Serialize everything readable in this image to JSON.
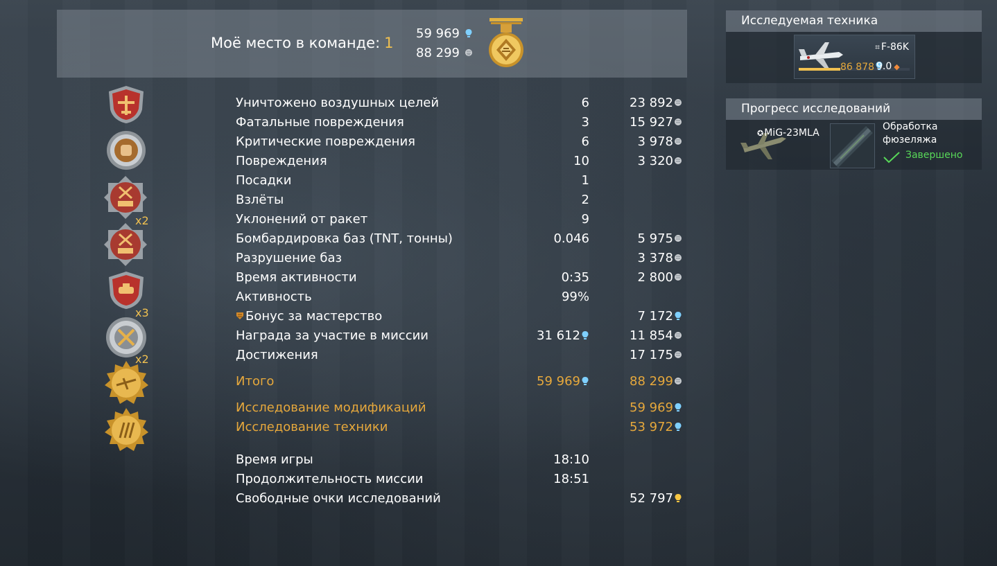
{
  "header": {
    "place_label": "Моё место в команде:",
    "place_value": "1",
    "rp_total": "59 969",
    "sl_total": "88 299"
  },
  "medal_multipliers": [
    "x2",
    "x3",
    "x2"
  ],
  "stats": [
    {
      "label": "Уничтожено воздушных целей",
      "v1": "6",
      "v2": "23 892",
      "v2_icon": "silver-lions-icon"
    },
    {
      "label": "Фатальные повреждения",
      "v1": "3",
      "v2": "15 927",
      "v2_icon": "silver-lions-icon"
    },
    {
      "label": "Критические повреждения",
      "v1": "6",
      "v2": "3 978",
      "v2_icon": "silver-lions-icon"
    },
    {
      "label": "Повреждения",
      "v1": "10",
      "v2": "3 320",
      "v2_icon": "silver-lions-icon"
    },
    {
      "label": "Посадки",
      "v1": "1",
      "v2": ""
    },
    {
      "label": "Взлёты",
      "v1": "2",
      "v2": ""
    },
    {
      "label": "Уклонений от ракет",
      "v1": "9",
      "v2": ""
    },
    {
      "label": "Бомбардировка баз (TNT, тонны)",
      "v1": "0.046",
      "v2": "5 975",
      "v2_icon": "silver-lions-icon"
    },
    {
      "label": "Разрушение баз",
      "v1": "",
      "v2": "3 378",
      "v2_icon": "silver-lions-icon"
    },
    {
      "label": "Время активности",
      "v1": "0:35",
      "v2": "2 800",
      "v2_icon": "silver-lions-icon"
    },
    {
      "label": "Активность",
      "v1": "99%",
      "v2": ""
    },
    {
      "label": "Бонус за мастерство",
      "v1": "",
      "v2": "7 172",
      "v2_icon": "research-points-icon"
    },
    {
      "label": "Награда за участие в миссии",
      "v1": "31 612",
      "v2": "11 854",
      "v1_icon": "research-points-icon",
      "v2_icon": "silver-lions-icon"
    },
    {
      "label": "Достижения",
      "v1": "",
      "v2": "17 175",
      "v2_icon": "silver-lions-icon"
    }
  ],
  "totals": {
    "total_label": "Итого",
    "total_rp": "59 969",
    "total_sl": "88 299",
    "mod_label": "Исследование модификаций",
    "mod_value": "59 969",
    "veh_label": "Исследование техники",
    "veh_value": "53 972"
  },
  "footer": [
    {
      "label": "Время игры",
      "v1": "18:10",
      "v2": ""
    },
    {
      "label": "Продолжительность миссии",
      "v1": "18:51",
      "v2": ""
    },
    {
      "label": "Свободные очки исследований",
      "v1": "",
      "v2": "52 797"
    }
  ],
  "research_panel": {
    "title": "Исследуемая техника",
    "vehicle_name": "F-86K",
    "vehicle_rp": "86 878",
    "vehicle_br": "9.0"
  },
  "progress_panel": {
    "title": "Прогресс исследований",
    "vehicle_name": "MiG-23MLA",
    "module_name": "Обработка фюзеляжа",
    "module_status": "Завершено"
  },
  "colors": {
    "gold_text": "#e6a83c",
    "place_number": "#f0c050",
    "completed_green": "#58d858",
    "rp_icon": "#7fd0ff",
    "free_rp_icon": "#f5c542"
  }
}
